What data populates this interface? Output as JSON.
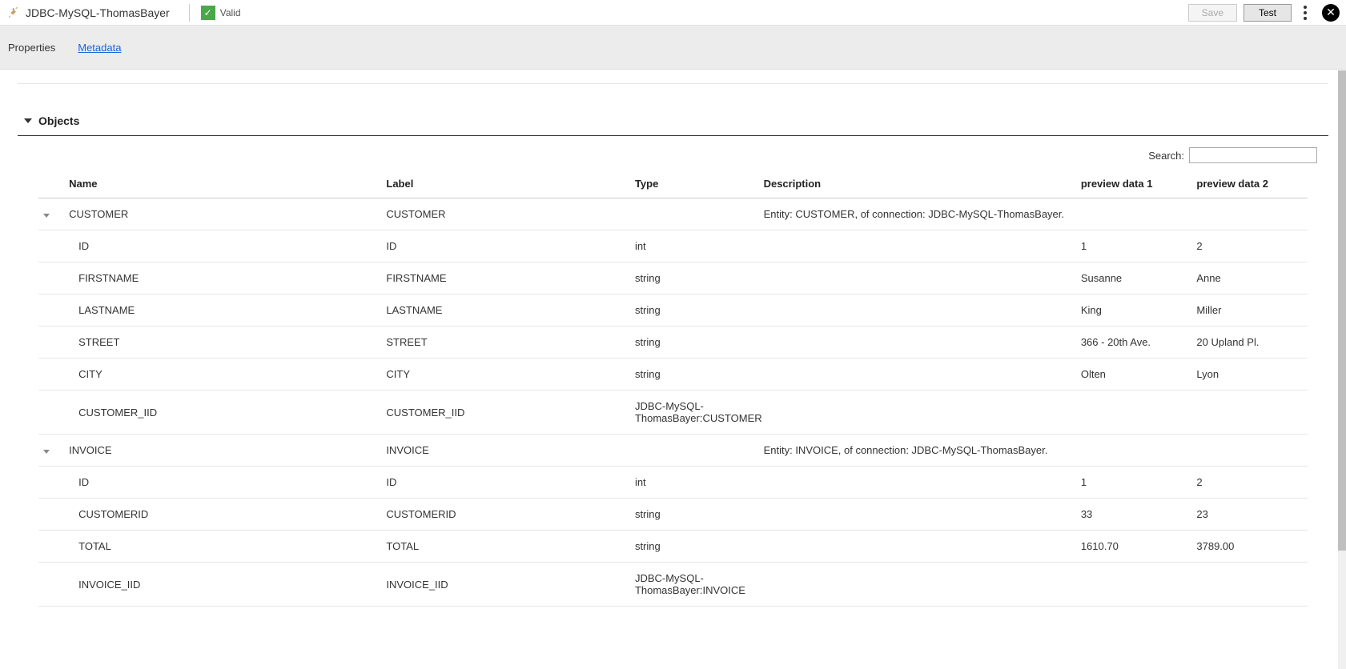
{
  "header": {
    "title": "JDBC-MySQL-ThomasBayer",
    "valid_label": "Valid",
    "save_label": "Save",
    "test_label": "Test"
  },
  "tabs": {
    "properties": "Properties",
    "metadata": "Metadata"
  },
  "section": {
    "title": "Objects",
    "search_label": "Search:",
    "search_value": ""
  },
  "columns": {
    "name": "Name",
    "label": "Label",
    "type": "Type",
    "description": "Description",
    "p1": "preview data 1",
    "p2": "preview data 2"
  },
  "groups": [
    {
      "name": "CUSTOMER",
      "label": "CUSTOMER",
      "type": "",
      "description": "Entity: CUSTOMER, of connection: JDBC-MySQL-ThomasBayer.",
      "p1": "",
      "p2": "",
      "rows": [
        {
          "name": "ID",
          "label": "ID",
          "type": "int",
          "description": "",
          "p1": "1",
          "p2": "2"
        },
        {
          "name": "FIRSTNAME",
          "label": "FIRSTNAME",
          "type": "string",
          "description": "",
          "p1": "Susanne",
          "p2": "Anne"
        },
        {
          "name": "LASTNAME",
          "label": "LASTNAME",
          "type": "string",
          "description": "",
          "p1": "King",
          "p2": "Miller"
        },
        {
          "name": "STREET",
          "label": "STREET",
          "type": "string",
          "description": "",
          "p1": "366 - 20th Ave.",
          "p2": "20 Upland Pl."
        },
        {
          "name": "CITY",
          "label": "CITY",
          "type": "string",
          "description": "",
          "p1": "Olten",
          "p2": "Lyon"
        },
        {
          "name": "CUSTOMER_IID",
          "label": "CUSTOMER_IID",
          "type": "JDBC-MySQL-ThomasBayer:CUSTOMER",
          "description": "",
          "p1": "",
          "p2": ""
        }
      ]
    },
    {
      "name": "INVOICE",
      "label": "INVOICE",
      "type": "",
      "description": "Entity: INVOICE, of connection: JDBC-MySQL-ThomasBayer.",
      "p1": "",
      "p2": "",
      "rows": [
        {
          "name": "ID",
          "label": "ID",
          "type": "int",
          "description": "",
          "p1": "1",
          "p2": "2"
        },
        {
          "name": "CUSTOMERID",
          "label": "CUSTOMERID",
          "type": "string",
          "description": "",
          "p1": "33",
          "p2": "23"
        },
        {
          "name": "TOTAL",
          "label": "TOTAL",
          "type": "string",
          "description": "",
          "p1": "1610.70",
          "p2": "3789.00"
        },
        {
          "name": "INVOICE_IID",
          "label": "INVOICE_IID",
          "type": "JDBC-MySQL-ThomasBayer:INVOICE",
          "description": "",
          "p1": "",
          "p2": ""
        }
      ]
    }
  ]
}
